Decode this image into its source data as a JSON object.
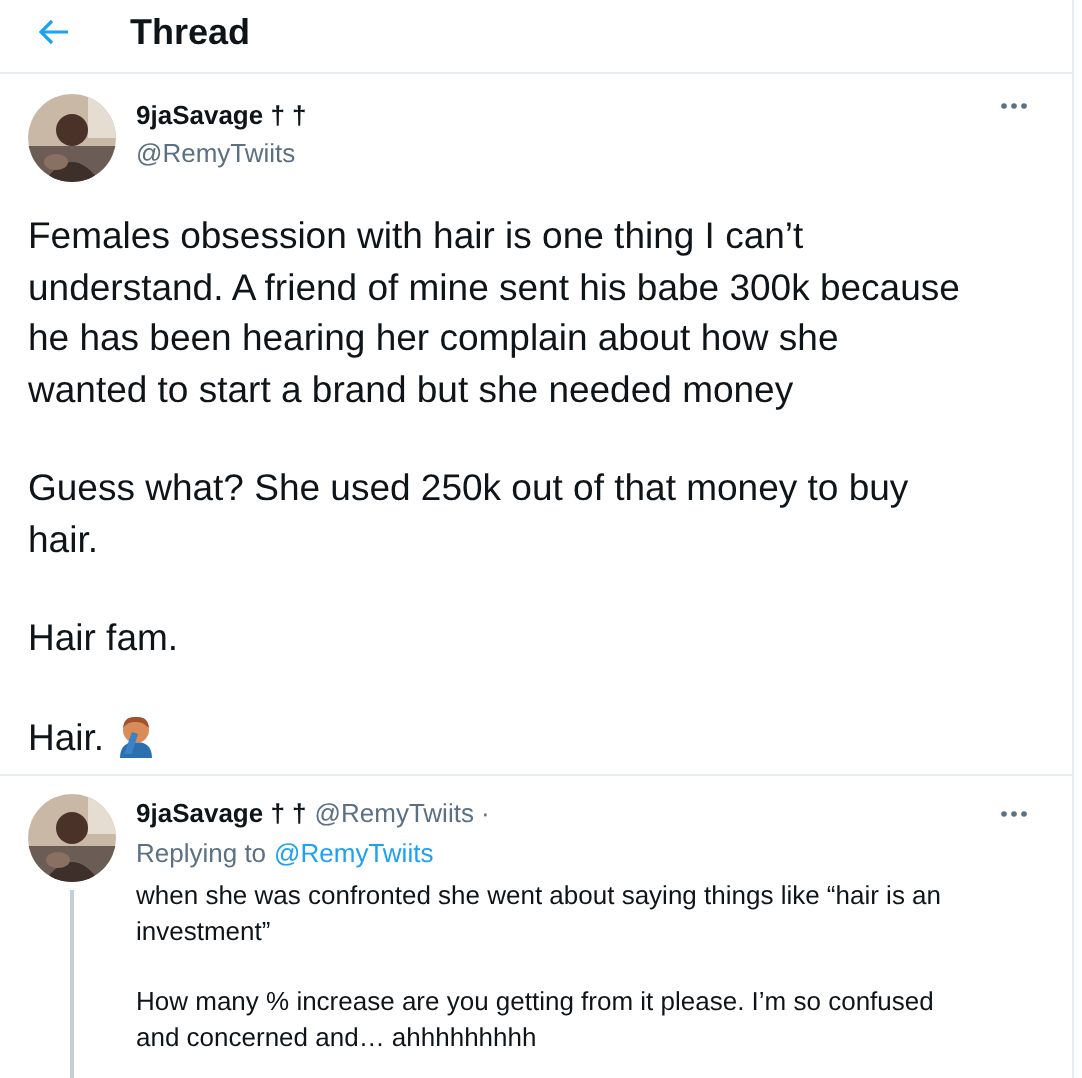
{
  "header": {
    "title": "Thread"
  },
  "tweet": {
    "name": "9jaSavage † †",
    "handle": "@RemyTwiits",
    "paragraphs": [
      "Females obsession with hair is one thing I can’t understand. A friend of mine sent his babe 300k because he has been hearing her complain about how she wanted to start a brand but she needed money",
      "Guess what? She used 250k out of that money to buy hair.",
      "Hair fam.",
      "Hair."
    ]
  },
  "reply": {
    "name": "9jaSavage † †",
    "handle": "@RemyTwiits ·",
    "replying_label": "Replying to",
    "replying_handle": "@RemyTwiits",
    "paragraphs": [
      "when she was confronted she went about saying things like “hair is an investment”",
      "How many % increase are you getting from it please. I’m so confused and concerned and… ahhhhhhhhh"
    ]
  }
}
